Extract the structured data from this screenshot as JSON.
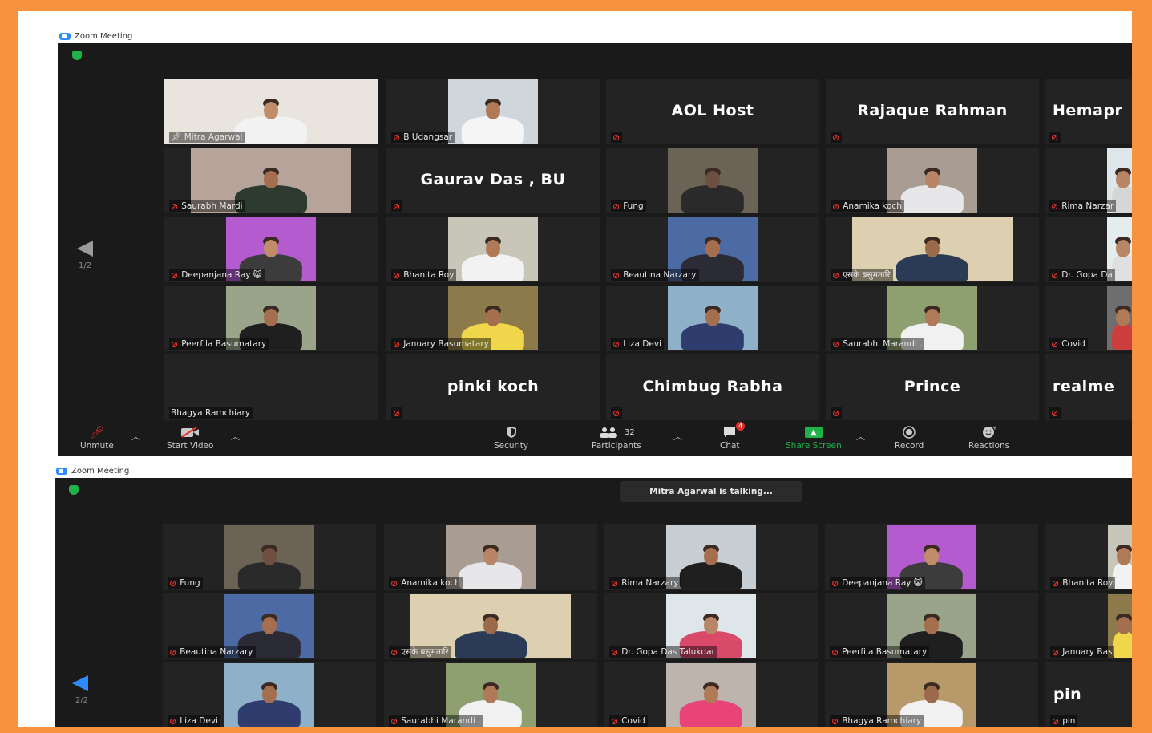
{
  "window_title": "Zoom Meeting",
  "top_meeting": {
    "page_indicator": "1/2",
    "tiles": [
      {
        "name": "Mitra Agarwal",
        "kind": "video",
        "active": true,
        "pinned": true,
        "muted": false
      },
      {
        "name": "B Udangsar",
        "kind": "video"
      },
      {
        "name": "AOL Host",
        "kind": "text"
      },
      {
        "name": "Rajaque Rahman",
        "kind": "text"
      },
      {
        "name": "Hemapr",
        "kind": "text"
      },
      {
        "name": "Saurabh Mardi",
        "kind": "video"
      },
      {
        "name": "Gaurav Das , BU",
        "kind": "text"
      },
      {
        "name": "Fung",
        "kind": "video"
      },
      {
        "name": "Anamika koch",
        "kind": "video"
      },
      {
        "name": "Rima Narzar",
        "kind": "video"
      },
      {
        "name": "Deepanjana Ray 😸",
        "kind": "video"
      },
      {
        "name": "Bhanita Roy",
        "kind": "video"
      },
      {
        "name": "Beautina Narzary",
        "kind": "video"
      },
      {
        "name": "एसके बसुमतारि",
        "kind": "video"
      },
      {
        "name": "Dr. Gopa Da",
        "kind": "video"
      },
      {
        "name": "Peerfila Basumatary",
        "kind": "video"
      },
      {
        "name": "January Basumatary",
        "kind": "video"
      },
      {
        "name": "Liza Devi",
        "kind": "video"
      },
      {
        "name": "Saurabhi Marandi .",
        "kind": "video"
      },
      {
        "name": "Covid",
        "kind": "video"
      },
      {
        "name": "Bhagya Ramchiary",
        "kind": "blank"
      },
      {
        "name": "pinki koch",
        "kind": "text"
      },
      {
        "name": "Chimbug Rabha",
        "kind": "text"
      },
      {
        "name": "Prince",
        "kind": "text"
      },
      {
        "name": "realme",
        "kind": "text"
      }
    ],
    "toolbar": {
      "unmute": "Unmute",
      "start_video": "Start Video",
      "security": "Security",
      "participants": "Participants",
      "participants_count": "32",
      "chat": "Chat",
      "chat_badge": "4",
      "share_screen": "Share Screen",
      "record": "Record",
      "reactions": "Reactions"
    }
  },
  "bottom_meeting": {
    "page_indicator": "2/2",
    "talking_banner": "Mitra Agarwal is talking...",
    "tiles": [
      {
        "name": "Fung"
      },
      {
        "name": "Anamika koch"
      },
      {
        "name": "Rima Narzary"
      },
      {
        "name": "Deepanjana Ray 😸"
      },
      {
        "name": "Bhanita Roy"
      },
      {
        "name": "Beautina Narzary"
      },
      {
        "name": "एसके बसुमतारि"
      },
      {
        "name": "Dr. Gopa Das Talukdar"
      },
      {
        "name": "Peerfila Basumatary"
      },
      {
        "name": "January Bas"
      },
      {
        "name": "Liza Devi"
      },
      {
        "name": "Saurabhi Marandi ."
      },
      {
        "name": "Covid"
      },
      {
        "name": "Bhagya Ramchiary"
      },
      {
        "name": "pin"
      }
    ]
  },
  "colors": {
    "border": "#f7923f",
    "zoom_bg": "#1a1a1a",
    "tile_bg": "#232323",
    "active_speaker": "#c8e244",
    "muted_red": "#e0322c",
    "share_green": "#1fb24a",
    "nav_arrow_top": "#9a9a9a",
    "nav_arrow_bottom": "#2d8cff"
  }
}
